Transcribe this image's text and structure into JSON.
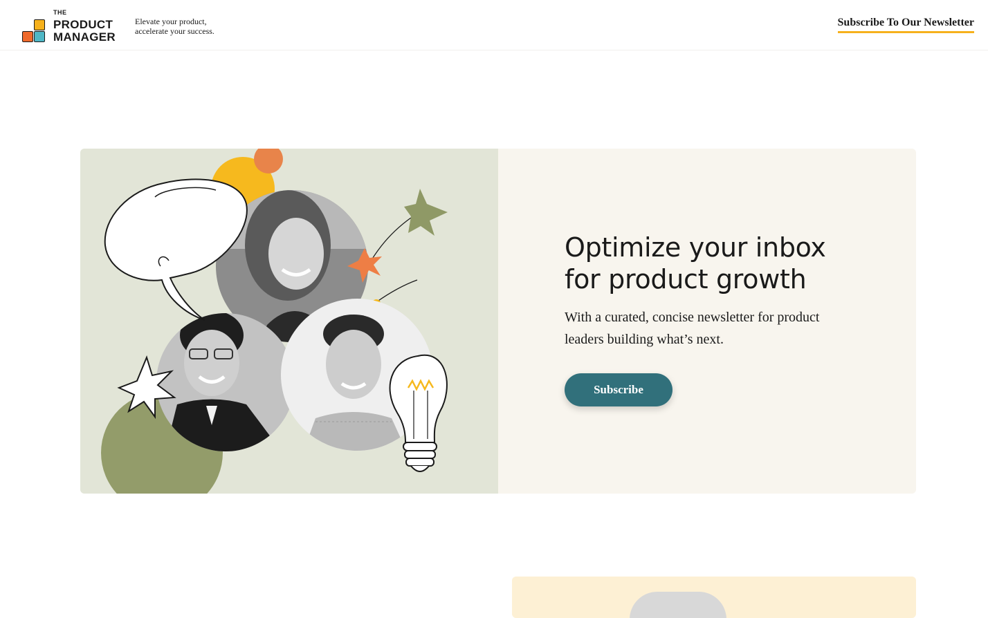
{
  "header": {
    "logo": {
      "line1": "THE",
      "line2": "PRODUCT",
      "line3": "MANAGER"
    },
    "tagline": {
      "line1": "Elevate your product,",
      "line2": "accelerate your success."
    },
    "cta_label": "Subscribe To Our Newsletter"
  },
  "hero": {
    "title_line1": "Optimize your inbox",
    "title_line2": "for product growth",
    "subtitle": "With a curated, concise newsletter for product leaders building what’s next.",
    "button_label": "Subscribe"
  },
  "colors": {
    "brand_yellow": "#f6b11c",
    "brand_orange": "#ef6a2c",
    "brand_teal": "#4fb7c6",
    "button_teal": "#31707b",
    "art_background": "#e2e5d7",
    "content_background": "#f8f5ee",
    "olive": "#939c6a"
  },
  "illustration": {
    "elements": [
      "speech-bubble-icon",
      "star-icon",
      "lightbulb-icon",
      "portrait-woman",
      "portrait-man-glasses",
      "portrait-man"
    ]
  }
}
